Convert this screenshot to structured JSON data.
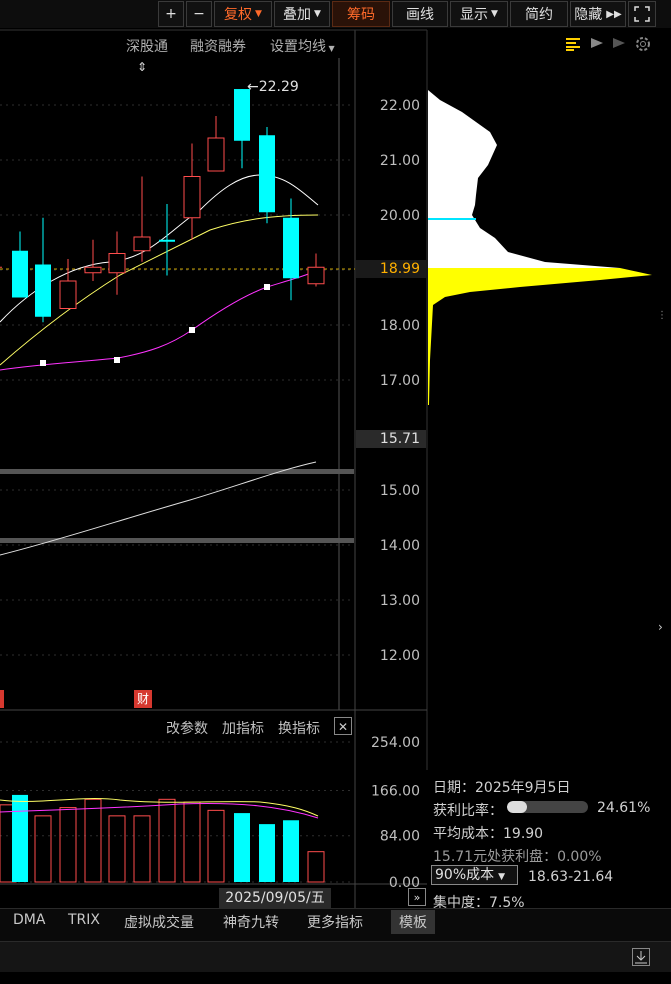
{
  "toolbar": {
    "plus": "+",
    "minus": "−",
    "fuquan": "复权",
    "diejia": "叠加",
    "chouma": "筹码",
    "huaxian": "画线",
    "xianshi": "显示",
    "jianyue": "简约",
    "yincang": "隐藏"
  },
  "subbar": {
    "sgt": "深股通",
    "rzrq": "融资融券",
    "setma": "设置均线"
  },
  "chart": {
    "high_label": "22.29",
    "current_price": "18.99",
    "low_price": "15.71",
    "y_ticks": [
      "22.00",
      "21.00",
      "20.00",
      "19.00",
      "18.00",
      "17.00",
      "15.00",
      "14.00",
      "13.00",
      "12.00"
    ],
    "cai_badge": "财",
    "date_label": "2025/09/05/五"
  },
  "chart_data": {
    "type": "candlestick",
    "ylim": [
      11.5,
      22.8
    ],
    "candles": [
      {
        "o": 18.5,
        "c": 19.35,
        "h": 19.7,
        "l": 18.95,
        "color": "cyan"
      },
      {
        "o": 19.1,
        "c": 18.15,
        "h": 19.95,
        "l": 18.05,
        "color": "cyan"
      },
      {
        "o": 18.3,
        "c": 18.8,
        "h": 19.2,
        "l": 18.3,
        "color": "red"
      },
      {
        "o": 18.95,
        "c": 19.05,
        "h": 19.55,
        "l": 18.8,
        "color": "red"
      },
      {
        "o": 18.95,
        "c": 19.3,
        "h": 19.7,
        "l": 18.55,
        "color": "red"
      },
      {
        "o": 19.35,
        "c": 19.6,
        "h": 20.7,
        "l": 19.15,
        "color": "red"
      },
      {
        "o": 19.55,
        "c": 19.55,
        "h": 20.2,
        "l": 18.9,
        "color": "cyan"
      },
      {
        "o": 19.95,
        "c": 20.7,
        "h": 21.3,
        "l": 19.55,
        "color": "red"
      },
      {
        "o": 20.8,
        "c": 21.4,
        "h": 21.8,
        "l": 20.8,
        "color": "red"
      },
      {
        "o": 22.29,
        "c": 21.35,
        "h": 22.29,
        "l": 20.85,
        "color": "cyan"
      },
      {
        "o": 21.45,
        "c": 20.05,
        "h": 21.6,
        "l": 19.85,
        "color": "cyan"
      },
      {
        "o": 19.95,
        "c": 18.85,
        "h": 20.3,
        "l": 18.45,
        "color": "cyan"
      },
      {
        "o": 18.75,
        "c": 19.05,
        "h": 19.3,
        "l": 18.7,
        "color": "red"
      }
    ],
    "volume": {
      "yticks": [
        "254.00",
        "166.00",
        "84.00",
        "0.00"
      ],
      "ymax": 254,
      "bars": [
        {
          "v": 140,
          "color": "red"
        },
        {
          "v": 158,
          "color": "cyan"
        },
        {
          "v": 120,
          "color": "red"
        },
        {
          "v": 135,
          "color": "red"
        },
        {
          "v": 150,
          "color": "red"
        },
        {
          "v": 120,
          "color": "red"
        },
        {
          "v": 120,
          "color": "red"
        },
        {
          "v": 150,
          "color": "red"
        },
        {
          "v": 145,
          "color": "red"
        },
        {
          "v": 130,
          "color": "red"
        },
        {
          "v": 125,
          "color": "cyan"
        },
        {
          "v": 105,
          "color": "cyan"
        },
        {
          "v": 112,
          "color": "cyan"
        },
        {
          "v": 55,
          "color": "red"
        }
      ]
    }
  },
  "indicator_bar": {
    "gcs": "改参数",
    "jzb": "加指标",
    "hzb": "换指标",
    "close": "✕"
  },
  "info_panel": {
    "date": "日期：2025年9月5日",
    "profit_ratio_label": "获利比率：",
    "profit_ratio_value": "24.61%",
    "profit_ratio_fraction": 0.2461,
    "avg_cost": "平均成本：19.90",
    "profit_at": "15.71元处获利盘：0.00%",
    "cost_select": "90%成本",
    "cost_range": "18.63-21.64",
    "concentration": "集中度：7.5%"
  },
  "bottom_tabs": [
    "DMA",
    "TRIX",
    "虚拟成交量",
    "神奇九转",
    "更多指标",
    "模板"
  ]
}
